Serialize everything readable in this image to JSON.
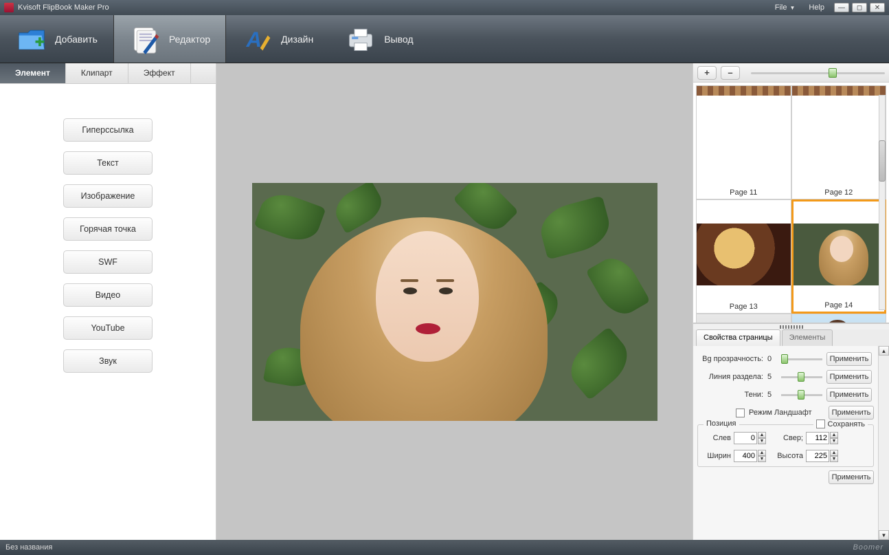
{
  "app": {
    "title": "Kvisoft FlipBook Maker Pro"
  },
  "menubar": {
    "file": "File",
    "help": "Help"
  },
  "toolbar": {
    "add": "Добавить",
    "editor": "Редактор",
    "design": "Дизайн",
    "output": "Вывод"
  },
  "left": {
    "tabs": {
      "element": "Элемент",
      "clipart": "Клипарт",
      "effect": "Эффект"
    },
    "buttons": {
      "hyperlink": "Гиперссылка",
      "text": "Текст",
      "image": "Изображение",
      "hotspot": "Горячая точка",
      "swf": "SWF",
      "video": "Видео",
      "youtube": "YouTube",
      "sound": "Звук"
    }
  },
  "thumbs": {
    "plus": "+",
    "minus": "–",
    "pages": {
      "p11": "Page 11",
      "p12": "Page 12",
      "p13": "Page 13",
      "p14": "Page 14"
    }
  },
  "props": {
    "tabs": {
      "page": "Свойства страницы",
      "elements": "Элементы"
    },
    "bg_transparency_label": "Bg прозрачность:",
    "bg_transparency_value": "0",
    "divider_label": "Линия раздела:",
    "divider_value": "5",
    "shadow_label": "Тени:",
    "shadow_value": "5",
    "landscape_label": "Режим Ландшафт",
    "apply": "Применить",
    "position_legend": "Позиция",
    "keep_label": "Сохранять",
    "left_label": "Слев",
    "left_value": "0",
    "top_label": "Свер;",
    "top_value": "112",
    "width_label": "Ширин",
    "width_value": "400",
    "height_label": "Высота",
    "height_value": "225"
  },
  "status": {
    "left": "Без названия",
    "right": "Boomer"
  },
  "colors": {
    "accent": "#f39a1a"
  }
}
